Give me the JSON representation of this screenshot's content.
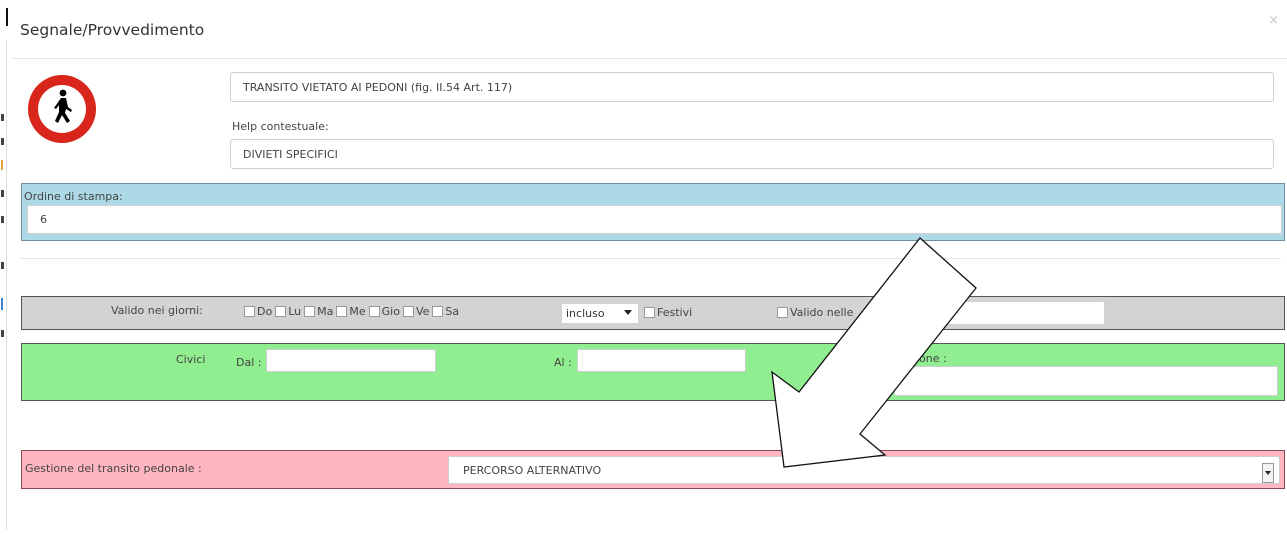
{
  "dialog": {
    "title": "Segnale/Provvedimento",
    "close_glyph": "×"
  },
  "signal": {
    "icon": "no-pedestrians-sign-icon",
    "name_value": "TRANSITO VIETATO AI PEDONI (fig. II.54 Art. 117)",
    "help_label": "Help contestuale:",
    "help_value": "DIVIETI SPECIFICI"
  },
  "print_order": {
    "label": "Ordine di stampa:",
    "value": "6"
  },
  "validity": {
    "label": "Valido nei giorni:",
    "days": [
      "Do",
      "Lu",
      "Ma",
      "Me",
      "Gio",
      "Ve",
      "Sa"
    ],
    "include_select": "incluso",
    "holidays_label": "Festivi",
    "valid_in_label": "Valido nelle"
  },
  "civic": {
    "label": "Civici",
    "from_label": "Dal :",
    "to_label": "Al :",
    "extra_label_fragment": "one :"
  },
  "pedestrian": {
    "label": "Gestione del transito pedonale :",
    "value": "PERCORSO ALTERNATIVO"
  },
  "colors": {
    "print_band": "#add8e6",
    "days_band": "#d3d3d3",
    "civic_band": "#90ee90",
    "pedestrian_band": "#ffb6c1"
  }
}
